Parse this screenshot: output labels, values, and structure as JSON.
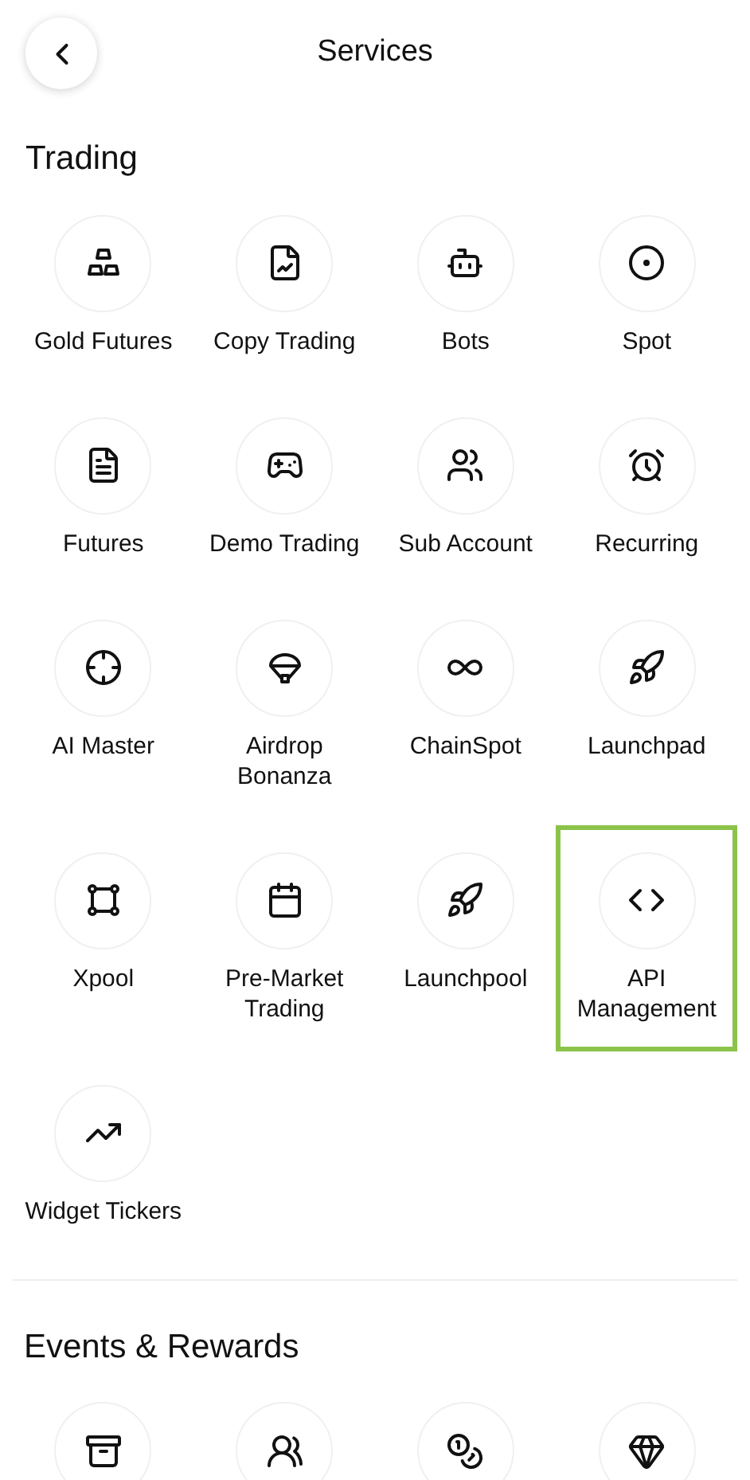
{
  "header": {
    "title": "Services"
  },
  "sections": [
    {
      "title": "Trading",
      "items": [
        {
          "label": "Gold Futures",
          "selected": false
        },
        {
          "label": "Copy Trading",
          "selected": false
        },
        {
          "label": "Bots",
          "selected": false
        },
        {
          "label": "Spot",
          "selected": false
        },
        {
          "label": "Futures",
          "selected": false
        },
        {
          "label": "Demo Trading",
          "selected": false
        },
        {
          "label": "Sub Account",
          "selected": false
        },
        {
          "label": "Recurring",
          "selected": false
        },
        {
          "label": "AI Master",
          "selected": false
        },
        {
          "label": "Airdrop Bonanza",
          "selected": false
        },
        {
          "label": "ChainSpot",
          "selected": false
        },
        {
          "label": "Launchpad",
          "selected": false
        },
        {
          "label": "Xpool",
          "selected": false
        },
        {
          "label": "Pre-Market Trading",
          "selected": false
        },
        {
          "label": "Launchpool",
          "selected": false
        },
        {
          "label": "API Management",
          "selected": true
        },
        {
          "label": "Widget Tickers",
          "selected": false
        }
      ]
    },
    {
      "title": "Events & Rewards",
      "items": [
        {
          "selected": false
        },
        {
          "selected": false
        },
        {
          "selected": false
        },
        {
          "selected": false
        }
      ]
    }
  ]
}
